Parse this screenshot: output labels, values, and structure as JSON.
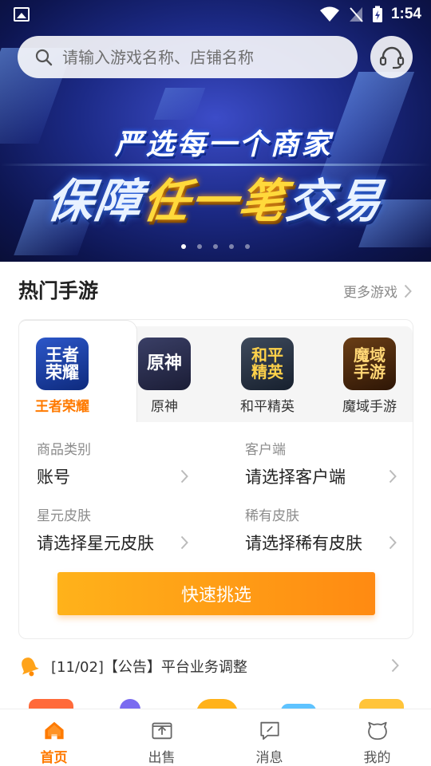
{
  "status_bar": {
    "time": "1:54"
  },
  "search": {
    "placeholder": "请输入游戏名称、店铺名称"
  },
  "banner": {
    "line1": "严选每一个商家",
    "line2_a": "保障",
    "line2_b": "任一笔",
    "line2_c": "交易",
    "slide_count": 5,
    "active_slide": 1
  },
  "hot_games": {
    "title": "热门手游",
    "more": "更多游戏",
    "games": [
      {
        "icon_text": "王者荣耀",
        "label": "王者荣耀",
        "active": true
      },
      {
        "icon_text": "原神",
        "label": "原神",
        "active": false
      },
      {
        "icon_text": "和平精英",
        "label": "和平精英",
        "active": false
      },
      {
        "icon_text": "魔域手游",
        "label": "魔域手游",
        "active": false
      }
    ]
  },
  "filters": {
    "category": {
      "label": "商品类别",
      "value": "账号"
    },
    "client": {
      "label": "客户端",
      "value": "请选择客户端"
    },
    "star_skin": {
      "label": "星元皮肤",
      "value": "请选择星元皮肤"
    },
    "rare_skin": {
      "label": "稀有皮肤",
      "value": "请选择稀有皮肤"
    }
  },
  "quick_button": "快速挑选",
  "notice": {
    "text": "[11/02]【公告】平台业务调整"
  },
  "nav": [
    {
      "label": "首页",
      "icon": "home-icon",
      "active": true
    },
    {
      "label": "出售",
      "icon": "upload-icon",
      "active": false
    },
    {
      "label": "消息",
      "icon": "message-icon",
      "active": false
    },
    {
      "label": "我的",
      "icon": "profile-icon",
      "active": false
    }
  ],
  "colors": {
    "accent": "#ff7a00",
    "button_start": "#ffb21a",
    "button_end": "#ff8a12"
  }
}
